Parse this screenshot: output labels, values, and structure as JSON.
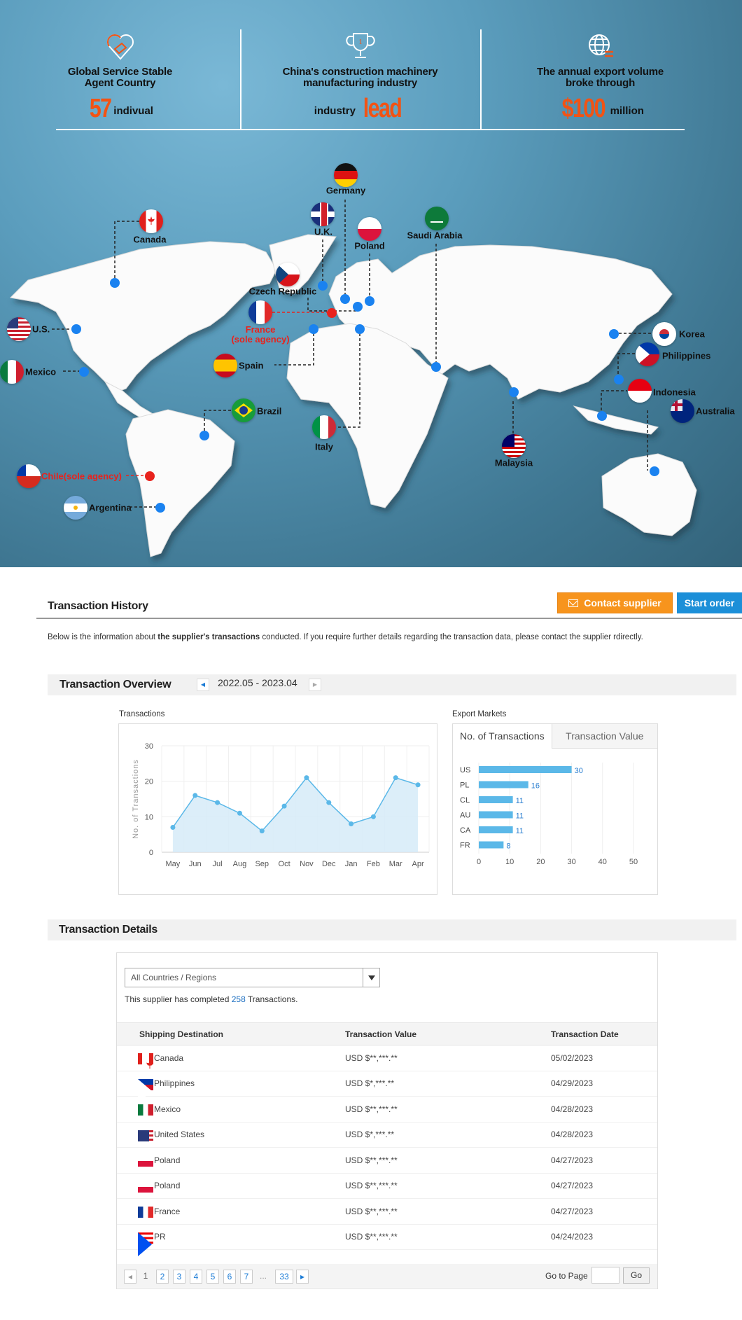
{
  "banner": {
    "stats": [
      {
        "icon": "handshake-heart-icon",
        "title_lines": [
          "Global Service Stable",
          "Agent Country"
        ],
        "big": "57",
        "suffix": "indivual"
      },
      {
        "icon": "trophy-icon",
        "title_lines": [
          "China's construction machinery",
          "manufacturing industry"
        ],
        "prefix": "industry",
        "big": "lead"
      },
      {
        "icon": "globe-exchange-icon",
        "title_lines": [
          "The annual export volume",
          "broke through"
        ],
        "big": "$100",
        "suffix": "million"
      }
    ],
    "markers": [
      {
        "name": "Canada",
        "flag": "ca"
      },
      {
        "name": "U.S.",
        "flag": "us"
      },
      {
        "name": "Mexico",
        "flag": "mx"
      },
      {
        "name": "Germany",
        "flag": "de"
      },
      {
        "name": "U.K.",
        "flag": "gb"
      },
      {
        "name": "Poland",
        "flag": "pl"
      },
      {
        "name": "Saudi Arabia",
        "flag": "sa"
      },
      {
        "name": "Czech Republic",
        "flag": "cz"
      },
      {
        "name": "France",
        "note": "(sole agency)",
        "flag": "fr"
      },
      {
        "name": "Spain",
        "flag": "es"
      },
      {
        "name": "Italy",
        "flag": "it"
      },
      {
        "name": "Brazil",
        "flag": "br"
      },
      {
        "name": "Chile(sole agency)",
        "flag": "cl"
      },
      {
        "name": "Argentina",
        "flag": "ar"
      },
      {
        "name": "Malaysia",
        "flag": "my"
      },
      {
        "name": "Korea",
        "flag": "kr"
      },
      {
        "name": "Philippines",
        "flag": "ph"
      },
      {
        "name": "Indonesia",
        "flag": "id"
      },
      {
        "name": "Australia",
        "flag": "au"
      }
    ]
  },
  "history": {
    "title": "Transaction History",
    "contact_label": "Contact supplier",
    "start_label": "Start order",
    "desc_pre": "Below is the information about ",
    "desc_bold": "the supplier's transactions",
    "desc_post": " conducted.  If you require further details regarding the transaction data, please contact the supplier  rdirectly."
  },
  "overview": {
    "title": "Transaction Overview",
    "range": "2022.05 - 2023.04",
    "transactions_label": "Transactions",
    "export_label": "Export Markets",
    "tabs": [
      "No. of Transactions",
      "Transaction Value"
    ]
  },
  "chart_data": [
    {
      "type": "area",
      "title": "Transactions",
      "ylabel": "No. of Transactions",
      "xlabel": "",
      "categories": [
        "May",
        "Jun",
        "Jul",
        "Aug",
        "Sep",
        "Oct",
        "Nov",
        "Dec",
        "Jan",
        "Feb",
        "Mar",
        "Apr"
      ],
      "values": [
        7,
        16,
        14,
        11,
        6,
        13,
        21,
        14,
        8,
        10,
        21,
        19
      ],
      "ylim": [
        0,
        30
      ],
      "yticks": [
        0,
        10,
        20,
        30
      ],
      "grid": true,
      "color": "#5bb8e8"
    },
    {
      "type": "bar",
      "orientation": "horizontal",
      "title": "Export Markets",
      "categories": [
        "US",
        "PL",
        "CL",
        "AU",
        "CA",
        "FR"
      ],
      "values": [
        30,
        16,
        11,
        11,
        11,
        8
      ],
      "xlim": [
        0,
        50
      ],
      "xticks": [
        0,
        10,
        20,
        30,
        40,
        50
      ],
      "color": "#5bb8e8"
    }
  ],
  "details": {
    "title": "Transaction Details",
    "select_value": "All Countries / Regions",
    "count_pre": "This supplier has completed ",
    "count": "258",
    "count_post": " Transactions.",
    "columns": [
      "Shipping Destination",
      "Transaction Value",
      "Transaction Date"
    ],
    "rows": [
      {
        "flag": "ca",
        "destination": "Canada",
        "value": "USD $**,***.**",
        "date": "05/02/2023"
      },
      {
        "flag": "ph",
        "destination": "Philippines",
        "value": "USD $*,***.**",
        "date": "04/29/2023"
      },
      {
        "flag": "mx",
        "destination": "Mexico",
        "value": "USD $**,***.**",
        "date": "04/28/2023"
      },
      {
        "flag": "us",
        "destination": "United States",
        "value": "USD $*,***.**",
        "date": "04/28/2023"
      },
      {
        "flag": "pl",
        "destination": "Poland",
        "value": "USD $**,***.**",
        "date": "04/27/2023"
      },
      {
        "flag": "pl",
        "destination": "Poland",
        "value": "USD $**,***.**",
        "date": "04/27/2023"
      },
      {
        "flag": "fr",
        "destination": "France",
        "value": "USD $**,***.**",
        "date": "04/27/2023"
      },
      {
        "flag": "pr",
        "destination": "PR",
        "value": "USD $**,***.**",
        "date": "04/24/2023"
      }
    ],
    "pagination": {
      "current": "1",
      "pages": [
        "2",
        "3",
        "4",
        "5",
        "6",
        "7"
      ],
      "ellipsis": "...",
      "last": "33",
      "goto_label": "Go to Page",
      "goto_value": "",
      "go_label": "Go"
    }
  }
}
